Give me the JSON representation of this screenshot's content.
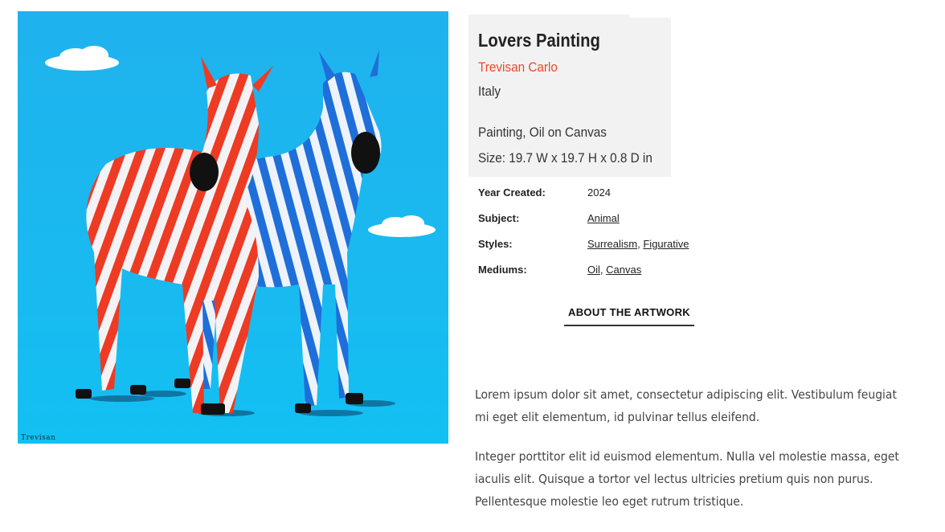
{
  "artwork": {
    "title": "Lovers Painting",
    "artist": "Trevisan Carlo",
    "country": "Italy",
    "medium": "Painting, Oil on Canvas",
    "size": "Size: 19.7 W x 19.7 H x 0.8 D in",
    "signature": "Trevisan"
  },
  "details": [
    {
      "label": "Year Created:",
      "values": [
        "2024"
      ],
      "links": false
    },
    {
      "label": "Subject:",
      "values": [
        "Animal"
      ],
      "links": true
    },
    {
      "label": "Styles:",
      "values": [
        "Surrealism",
        "Figurative"
      ],
      "links": true
    },
    {
      "label": "Mediums:",
      "values": [
        "Oil",
        "Canvas"
      ],
      "links": true
    }
  ],
  "about_tab_label": "ABOUT THE ARTWORK",
  "description": {
    "p1": [
      "Lorem ipsum dolor sit amet, consectetur adipiscing elit. Vestibulum feugiat",
      "mi eget elit elementum, id pulvinar tellus eleifend."
    ],
    "p2": [
      "Integer porttitor elit id euismod elementum. Nulla vel molestie massa, eget",
      "iaculis elit. Quisque a tortor vel lectus ultricies pretium quis non purus.",
      "Pellentesque molestie leo eget rutrum tristique."
    ]
  },
  "colors": {
    "sky": "#1ab9f0",
    "red_zebra": "#ee3b24",
    "blue_zebra": "#1e6fd9",
    "artist_link": "#e84a2a"
  }
}
